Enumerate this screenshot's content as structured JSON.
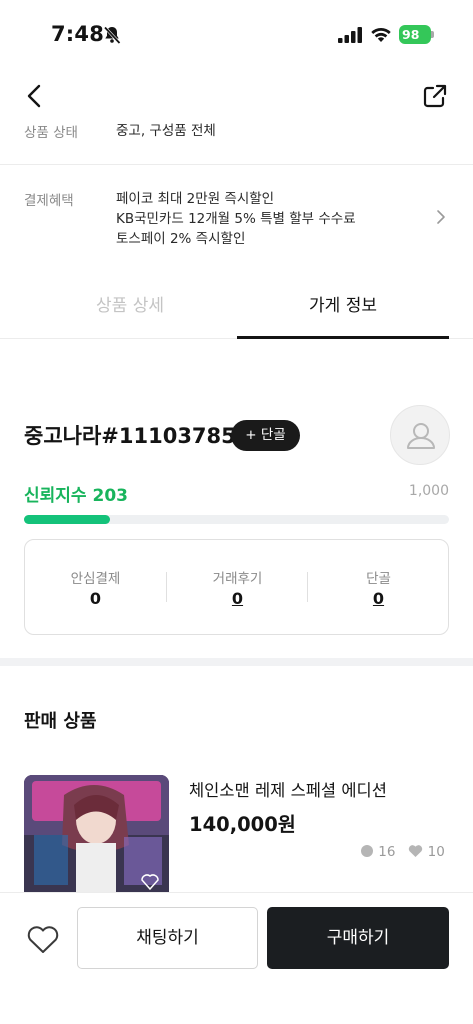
{
  "status_bar": {
    "time": "7:48",
    "battery": "98"
  },
  "product_info": {
    "condition_label": "상품 상태",
    "condition_value": "중고, 구성품 전체",
    "benefit_label": "결제혜택",
    "benefits": [
      "페이코 최대 2만원 즉시할인",
      "KB국민카드 12개월 5% 특별 할부 수수료",
      "토스페이 2% 즉시할인"
    ]
  },
  "tabs": [
    {
      "label": "상품 상세",
      "active": false
    },
    {
      "label": "가게 정보",
      "active": true
    }
  ],
  "store": {
    "name": "중고나라#11103785",
    "regular_button": "+ 단골",
    "trust_label": "신뢰지수",
    "trust_score": "203",
    "trust_max": "1,000",
    "trust_fraction": 0.203,
    "stats": [
      {
        "label": "안심결제",
        "value": "0",
        "underline": false
      },
      {
        "label": "거래후기",
        "value": "0",
        "underline": true
      },
      {
        "label": "단골",
        "value": "0",
        "underline": true
      }
    ]
  },
  "selling": {
    "title": "판매 상품",
    "items": [
      {
        "title": "체인소맨 레제 스페셜 에디션",
        "price": "140,000원",
        "chats": "16",
        "likes": "10"
      }
    ]
  },
  "bottom_bar": {
    "chat_label": "채팅하기",
    "buy_label": "구매하기"
  },
  "colors": {
    "accent_green": "#18b45c",
    "dark": "#1b1e21"
  }
}
